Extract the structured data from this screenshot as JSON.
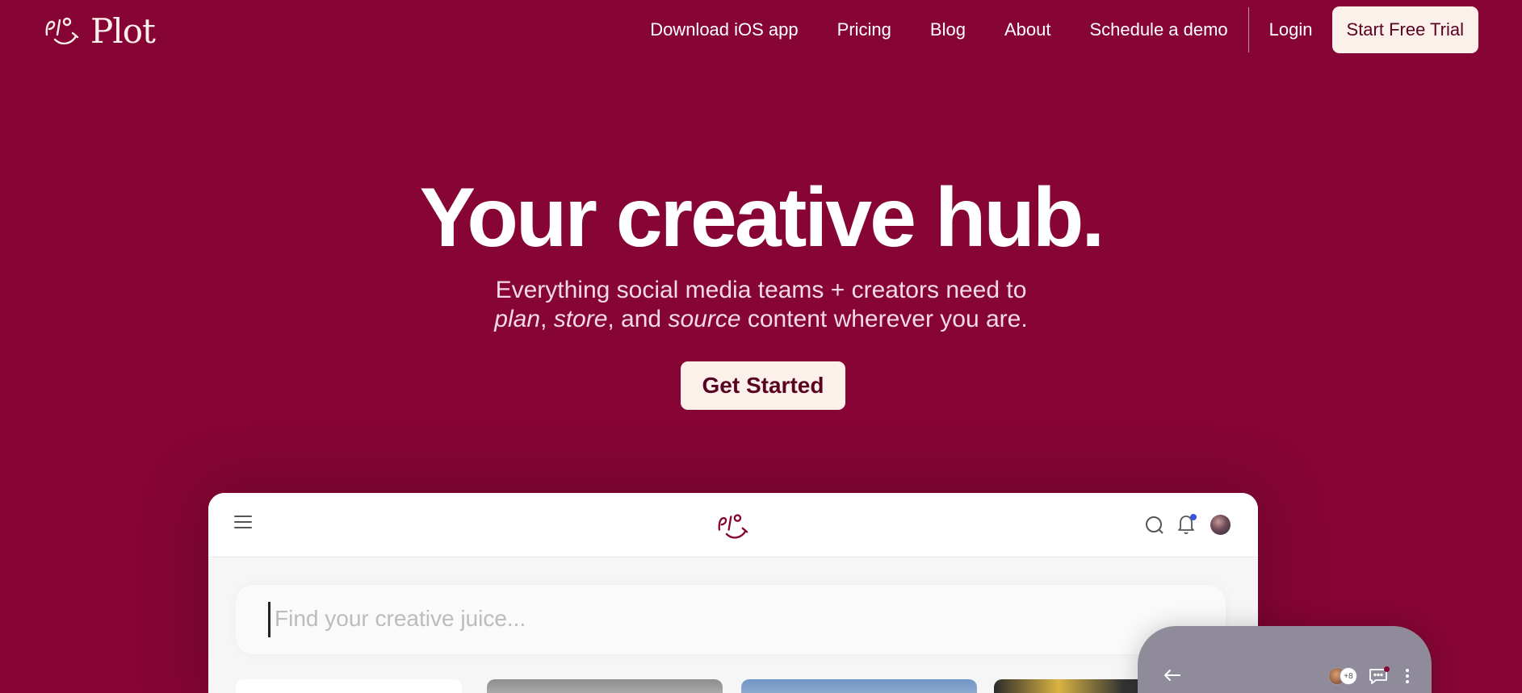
{
  "brand": {
    "name": "Plot"
  },
  "nav": {
    "links": [
      "Download iOS app",
      "Pricing",
      "Blog",
      "About",
      "Schedule a demo"
    ],
    "login": "Login",
    "trial": "Start Free Trial"
  },
  "hero": {
    "title": "Your creative hub.",
    "subtitle_line1": "Everything social media teams + creators need to",
    "sub_plan": "plan",
    "sub_sep1": ", ",
    "sub_store": "store",
    "sub_sep2": ", and ",
    "sub_source": "source",
    "sub_tail": " content wherever you are.",
    "cta": "Get Started"
  },
  "app_preview": {
    "search_placeholder": "Find your creative juice...",
    "phone": {
      "collaborators_extra": "+8"
    }
  },
  "colors": {
    "background": "#860535",
    "button_bg": "#fcf1ea",
    "button_text": "#5a0222",
    "notification_dot": "#3b55d9"
  },
  "icons": [
    "menu-icon",
    "search-icon",
    "bell-icon",
    "back-arrow-icon",
    "chat-icon",
    "more-vertical-icon"
  ]
}
